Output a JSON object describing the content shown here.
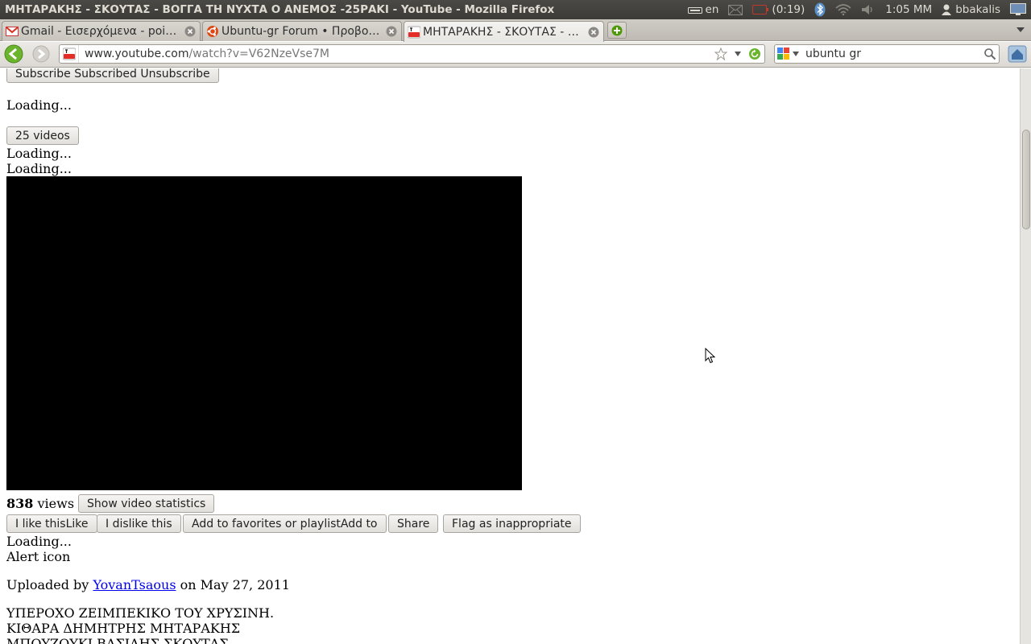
{
  "window": {
    "title": "ΜΗΤΑΡΑΚΗΣ - ΣΚΟΥΤΑΣ - ΒΟΓΓΑ ΤΗ ΝΥΧΤΑ Ο ΑΝΕΜΟΣ -25ΡΑΚΙ - YouTube - Mozilla Firefox"
  },
  "indicators": {
    "keyboard": "en",
    "battery": "(0:19)",
    "clock": "1:05 ΜΜ",
    "user": "bbakalis"
  },
  "tabs": [
    {
      "label": "Gmail - Εισερχόμενα - poios...",
      "icon": "gmail-icon",
      "active": false
    },
    {
      "label": "Ubuntu-gr Forum • Προβολή...",
      "icon": "ubuntu-icon",
      "active": false
    },
    {
      "label": "ΜΗΤΑΡΑΚΗΣ - ΣΚΟΥΤΑΣ - Β...",
      "icon": "youtube-icon",
      "active": true
    }
  ],
  "nav": {
    "url_host": "www.youtube.com",
    "url_path": "/watch?v=V62NzeVse7M",
    "search_value": "ubuntu gr"
  },
  "content": {
    "subscribe_button": "Subscribe Subscribed Unsubscribe",
    "loading_1": "Loading...",
    "videos_button": "25 videos",
    "loading_2": "Loading...",
    "loading_3": "Loading...",
    "views_count": "838",
    "views_label": "views",
    "stats_button": "Show video statistics",
    "like_button": "I like thisLike",
    "dislike_button": "I dislike this",
    "favorites_button": "Add to favorites or playlistAdd to",
    "share_button": "Share",
    "flag_button": "Flag as inappropriate",
    "loading_4": "Loading...",
    "alert_icon_text": "Alert icon",
    "uploaded_by": "Uploaded by",
    "uploader": "YovanTsaous",
    "uploaded_on": "on May 27, 2011",
    "description_lines": [
      "ΥΠΕΡΟΧΟ ΖΕΙΜΠΕΚΙΚΟ ΤΟΥ ΧΡΥΣΙΝΗ.",
      "ΚΙΘΑΡΑ ΔΗΜΗΤΡΗΣ ΜΗΤΑΡΑΚΗΣ",
      "ΜΠΟΥΖΟΥΚΙ ΒΑΣΙΛΗΣ ΣΚΟΥΤΑΣ"
    ]
  },
  "colors": {
    "panel_bg": "#3c3b37",
    "link": "#0000ee",
    "player_bg": "#000000"
  }
}
